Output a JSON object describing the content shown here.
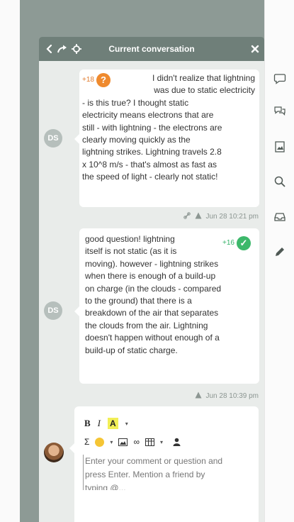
{
  "panel": {
    "title": "Current conversation",
    "back_icon": "chevron-left-icon",
    "forward_icon": "share-arrow-icon",
    "target_icon": "crosshair-icon",
    "close_icon": "close-icon"
  },
  "messages": [
    {
      "avatar_initials": "DS",
      "score": "+18",
      "badge_symbol": "?",
      "badge_color": "#ef8a2e",
      "lines": [
        "I didn't realize that lightning",
        "was due to static electricity",
        "- is this true? I thought static",
        "electricity means electrons that are",
        "still - with lightning - the electrons are",
        "clearly moving quickly as the",
        "lightning strikes. Lightning travels 2.8",
        "x 10^8 m/s - that's almost as fast as",
        "the speed of light - clearly not static!"
      ],
      "timestamp": "Jun 28 10:21 pm"
    },
    {
      "avatar_initials": "DS",
      "score": "+16",
      "badge_symbol": "✓",
      "badge_color": "#3cb86a",
      "lines": [
        "good question! lightning",
        "itself is not static (as it is",
        "moving). however - lightning strikes",
        "when there is enough of a build-up",
        "on charge (in the clouds - compared",
        "to the ground) that there is a",
        "breakdown of the air that separates",
        "the clouds from the air. Lightning",
        "doesn't happen without enough of a",
        "build-up of static charge."
      ],
      "timestamp": "Jun 28 10:39 pm"
    }
  ],
  "composer": {
    "toolbar": {
      "bold": "B",
      "italic": "I",
      "highlight": "A",
      "sigma": "Σ",
      "link": "∞"
    },
    "placeholder_lines": [
      "Enter your comment or question and",
      "press Enter. Mention a friend by",
      "typing @..."
    ]
  },
  "rail": [
    "chat-bubble-icon",
    "chat-bubbles-icon",
    "image-icon",
    "search-icon",
    "inbox-icon",
    "pencil-icon"
  ]
}
